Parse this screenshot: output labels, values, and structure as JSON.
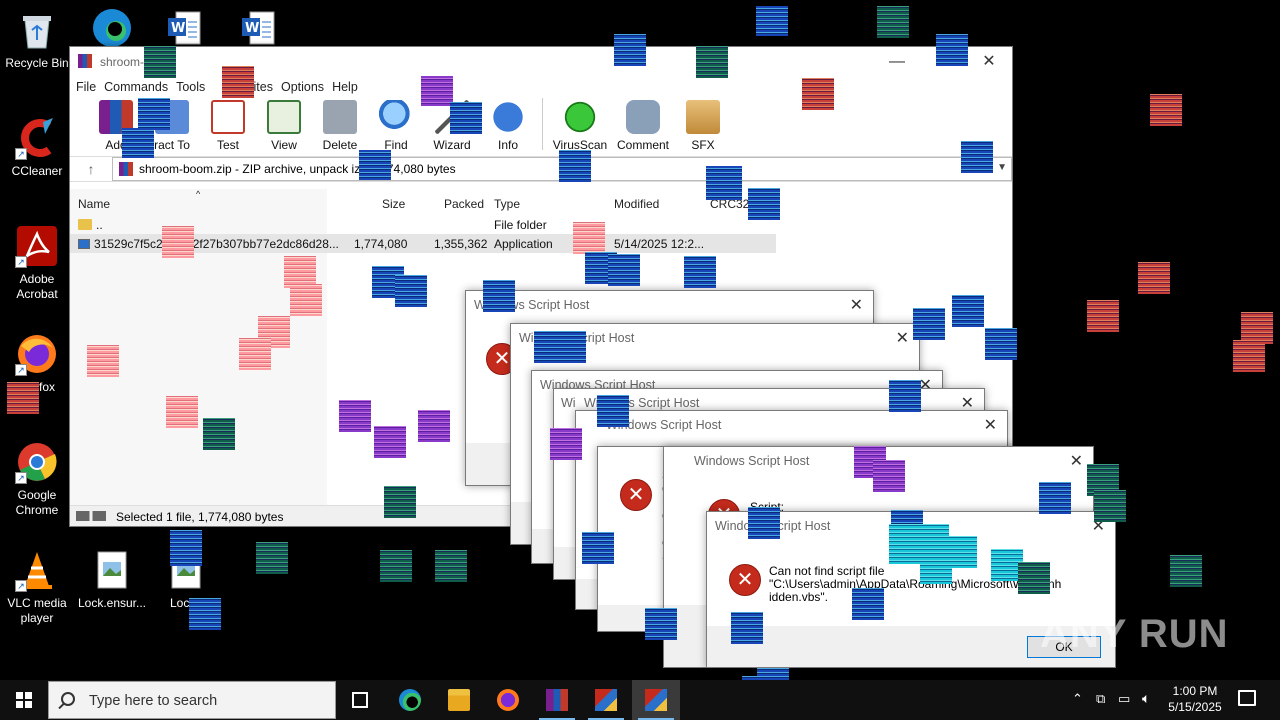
{
  "desktop": {
    "icons": [
      {
        "label": "Recycle Bin"
      },
      {
        "label": "CCleaner"
      },
      {
        "label": "Adobe Acrobat"
      },
      {
        "label": "fox"
      },
      {
        "label": "Google Chrome"
      },
      {
        "label": "VLC media player"
      },
      {
        "label": "Lock.ensur..."
      },
      {
        "label": "Lock.t"
      }
    ]
  },
  "winrar": {
    "title": "shroom-      .zip",
    "menu": [
      "File",
      "Commands",
      "Tools",
      "vites",
      "Options",
      "Help"
    ],
    "toolbar": [
      {
        "label": "Add",
        "icon": "add-archive-icon"
      },
      {
        "label": "ract To",
        "icon": "extract-icon"
      },
      {
        "label": "Test",
        "icon": "test-icon"
      },
      {
        "label": "View",
        "icon": "view-book-icon"
      },
      {
        "label": "Delete",
        "icon": "trash-icon"
      },
      {
        "label": "Find",
        "icon": "magnifier-icon"
      },
      {
        "label": "Wizard",
        "icon": "wand-icon"
      },
      {
        "label": "Info",
        "icon": "info-icon"
      },
      {
        "label": "VirusScan",
        "icon": "virus-scan-icon"
      },
      {
        "label": "Comment",
        "icon": "comment-icon"
      },
      {
        "label": "SFX",
        "icon": "sfx-box-icon"
      }
    ],
    "address": "shroom-boom.zip - ZIP archive, unpack     ize 1,774,080 bytes",
    "columns": {
      "name": "Name",
      "size": "Size",
      "packed": "Packed",
      "type": "Type",
      "modified": "Modified",
      "crc": "CRC32"
    },
    "rows": [
      {
        "name": "..",
        "size": "",
        "packed": "",
        "type": "File folder",
        "modified": ""
      },
      {
        "name": "31529c7f5c2f0a572f27b307bb77e2dc86d28...",
        "size": "1,774,080",
        "packed": "1,355,362",
        "type": "Application",
        "modified": "5/14/2025 12:2..."
      }
    ],
    "status": "Selected 1 file, 1,774,080 bytes"
  },
  "dialogs": {
    "title": "Windows Script Host",
    "script_label": "Script:",
    "message_line1": "Can not find script file",
    "message_line2": "\"C:\\Users\\admin\\AppData\\Roaming\\Microsoft\\W          s\\winh",
    "message_line3": "idden.vbs\".",
    "ok": "OK",
    "partial_lines": [
      "S",
      "C",
      "L",
      "C",
      "E",
      "C",
      "S"
    ]
  },
  "taskbar": {
    "search_placeholder": "Type here to search",
    "time": "1:00 PM",
    "date": "5/15/2025"
  },
  "watermark": "ANY RUN",
  "colors": {
    "error_red": "#c42b1c",
    "taskbar": "#101010",
    "accent": "#0078d7"
  }
}
